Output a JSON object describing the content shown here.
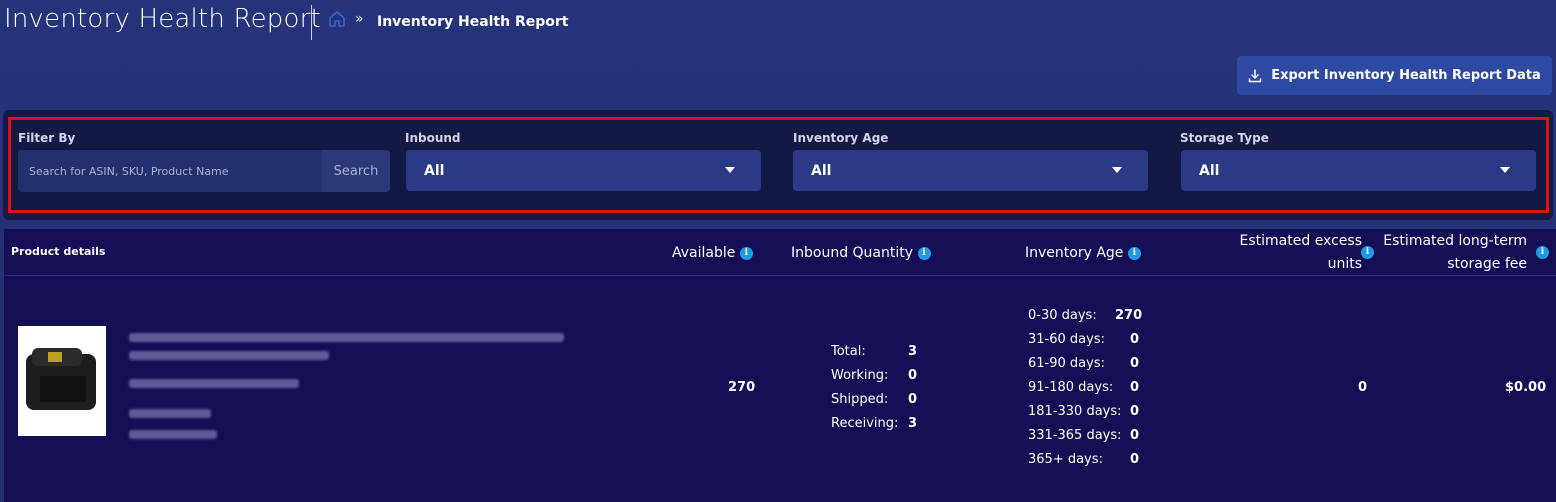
{
  "header": {
    "title": "Inventory Health Report",
    "breadcrumb_sep": "»",
    "breadcrumb_current": "Inventory Health Report"
  },
  "export_button": {
    "label": "Export Inventory Health Report Data"
  },
  "filters": {
    "filter_by_label": "Filter By",
    "search_placeholder": "Search for ASIN, SKU, Product Name",
    "search_value": "",
    "search_button": "Search",
    "inbound": {
      "label": "Inbound",
      "selected": "All"
    },
    "inventory_age": {
      "label": "Inventory Age",
      "selected": "All"
    },
    "storage_type": {
      "label": "Storage Type",
      "selected": "All"
    }
  },
  "table": {
    "headers": {
      "product_details": "Product details",
      "available": "Available",
      "inbound_quantity": "Inbound Quantity",
      "inventory_age": "Inventory Age",
      "excess_line1": "Estimated excess",
      "excess_line2": "units",
      "fee_line1": "Estimated long-term",
      "fee_line2": "storage fee"
    },
    "row": {
      "available": "270",
      "inbound": [
        {
          "label": "Total:",
          "value": "3"
        },
        {
          "label": "Working:",
          "value": "0"
        },
        {
          "label": "Shipped:",
          "value": "0"
        },
        {
          "label": "Receiving:",
          "value": "3"
        }
      ],
      "age": [
        {
          "label": "0-30 days:",
          "value": "270"
        },
        {
          "label": "31-60 days:",
          "value": "0"
        },
        {
          "label": "61-90 days:",
          "value": "0"
        },
        {
          "label": "91-180 days:",
          "value": "0"
        },
        {
          "label": "181-330 days:",
          "value": "0"
        },
        {
          "label": "331-365 days:",
          "value": "0"
        },
        {
          "label": "365+ days:",
          "value": "0"
        }
      ],
      "excess_units": "0",
      "storage_fee": "$0.00"
    }
  },
  "colors": {
    "background": "#25337a",
    "panel": "#141844",
    "highlight": "#e01010",
    "accent": "#2f4aa3",
    "info": "#1e9be6"
  },
  "icons": [
    "home-icon",
    "download-icon",
    "chevron-down-icon",
    "info-icon"
  ]
}
